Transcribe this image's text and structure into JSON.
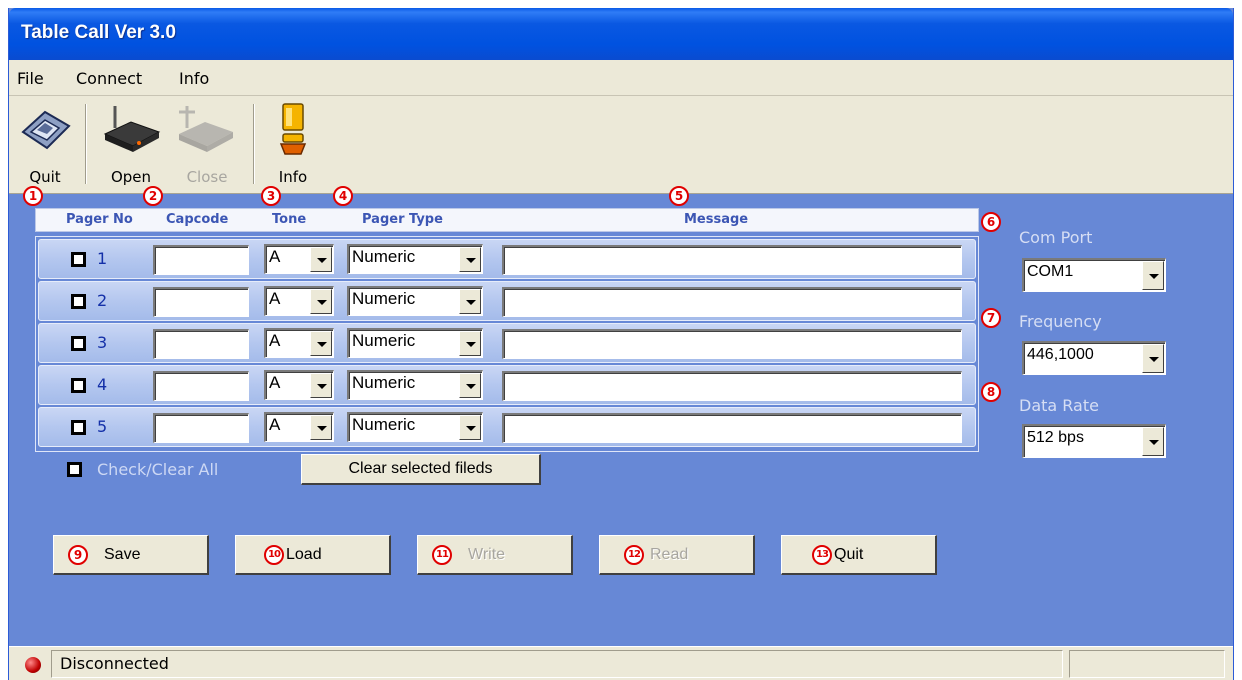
{
  "window": {
    "title": "Table Call Ver 3.0"
  },
  "menu": [
    "File",
    "Connect",
    "Info"
  ],
  "toolbar": {
    "quit": "Quit",
    "open": "Open",
    "close": "Close",
    "info": "Info"
  },
  "callouts": [
    "1",
    "2",
    "3",
    "4",
    "5",
    "6",
    "7",
    "8",
    "9",
    "10",
    "11",
    "12",
    "13"
  ],
  "table": {
    "headers": {
      "pager_no": "Pager No",
      "capcode": "Capcode",
      "tone": "Tone",
      "pager_type": "Pager Type",
      "message": "Message"
    },
    "rows": [
      {
        "num": "1",
        "capcode": "",
        "tone": "A",
        "type": "Numeric",
        "message": ""
      },
      {
        "num": "2",
        "capcode": "",
        "tone": "A",
        "type": "Numeric",
        "message": ""
      },
      {
        "num": "3",
        "capcode": "",
        "tone": "A",
        "type": "Numeric",
        "message": ""
      },
      {
        "num": "4",
        "capcode": "",
        "tone": "A",
        "type": "Numeric",
        "message": ""
      },
      {
        "num": "5",
        "capcode": "",
        "tone": "A",
        "type": "Numeric",
        "message": ""
      }
    ]
  },
  "check_all_label": "Check/Clear All",
  "clear_button": "Clear selected fileds",
  "settings": {
    "com_port_label": "Com Port",
    "com_port": "COM1",
    "frequency_label": "Frequency",
    "frequency": "446,1000",
    "data_rate_label": "Data Rate",
    "data_rate": "512 bps"
  },
  "buttons": {
    "save": "Save",
    "load": "Load",
    "write": "Write",
    "read": "Read",
    "quit": "Quit"
  },
  "status": {
    "text": "Disconnected",
    "led_color": "#c00000"
  },
  "colors": {
    "window_bg": "#6788d6",
    "titlebar": "#0052e0",
    "chrome": "#ece9d8",
    "callout": "#e00000"
  }
}
